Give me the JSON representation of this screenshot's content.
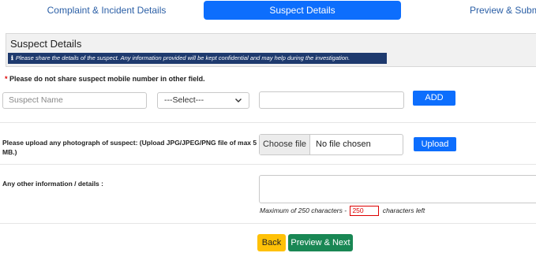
{
  "tabs": {
    "complaint": "Complaint & Incident Details",
    "suspect": "Suspect Details",
    "preview": "Preview & Submit"
  },
  "section": {
    "title": "Suspect Details",
    "info": "Please share the details of the suspect. Any information provided will be kept confidential and may help during the investigation."
  },
  "warning": {
    "star": "*",
    "text": "Please do not share suspect mobile number in other field."
  },
  "suspect_form": {
    "name_placeholder": "Suspect Name",
    "select_value": "---Select---",
    "id_value": "",
    "add_label": "ADD"
  },
  "upload": {
    "label": "Please upload any photograph of suspect: (Upload JPG/JPEG/PNG file of max 5 MB.)",
    "choose_label": "Choose file",
    "status": "No file chosen",
    "upload_label": "Upload"
  },
  "other_info": {
    "label": "Any other information / details :",
    "counter_prefix": "Maximum of 250 characters -",
    "counter_value": "250",
    "counter_suffix": "characters left"
  },
  "actions": {
    "back": "Back",
    "next": "Preview & Next"
  },
  "colors": {
    "primary": "#0d6efd",
    "info_bar": "#1e3a6e",
    "back": "#ffc107",
    "next": "#198754",
    "danger": "#dd0000"
  }
}
